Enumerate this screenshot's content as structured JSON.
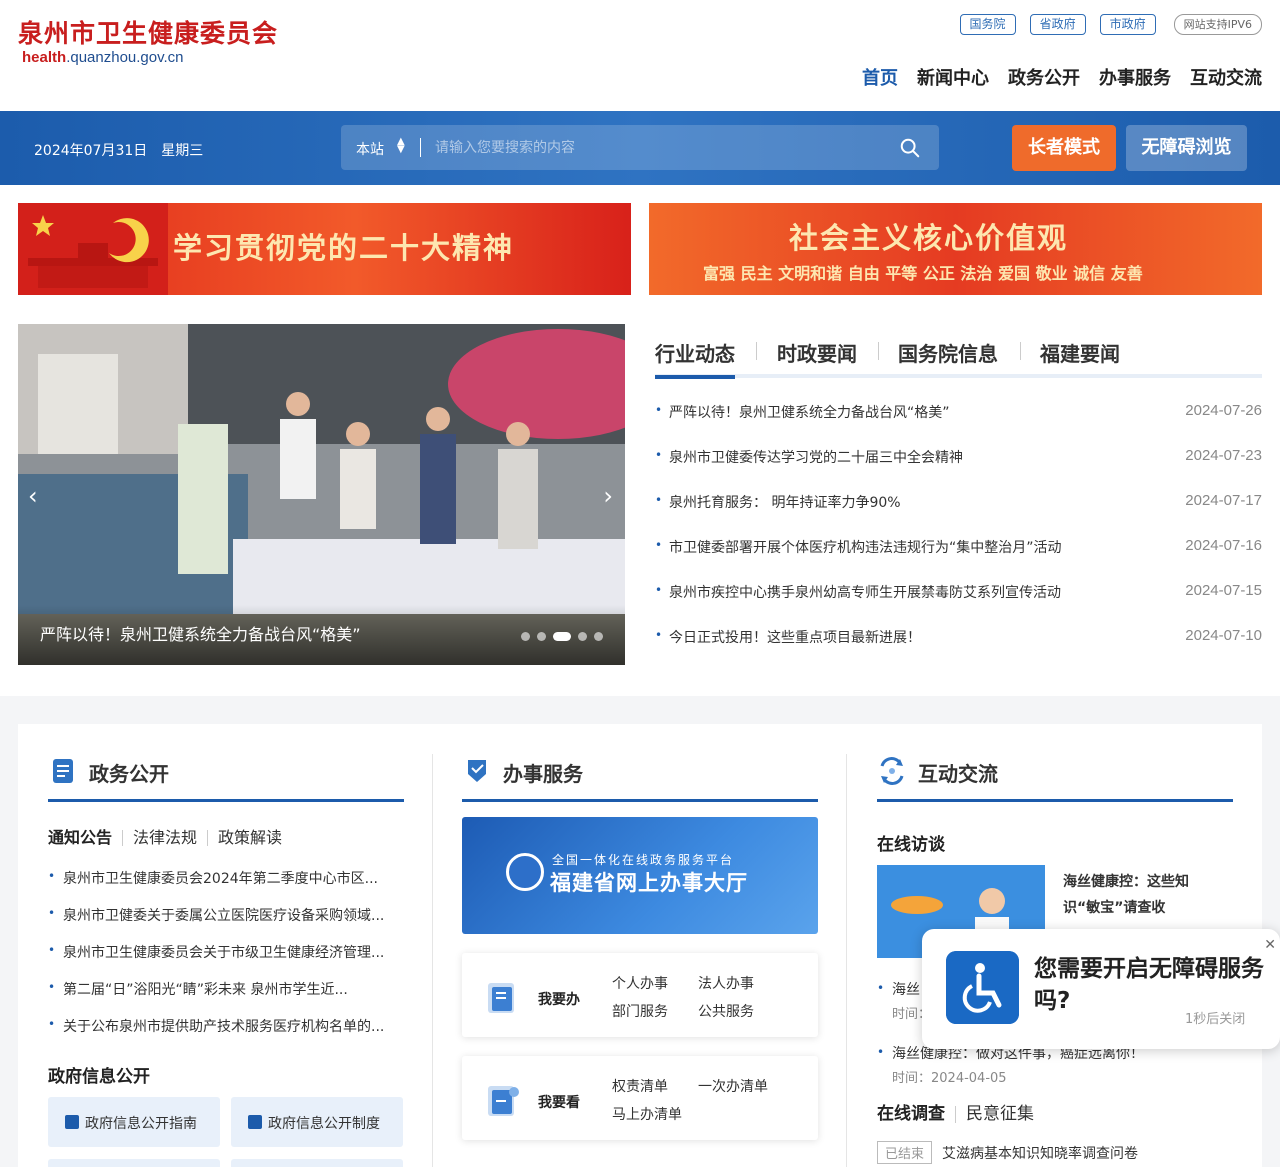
{
  "header": {
    "logo_cn": "泉州市卫生健康委员会",
    "logo_en_prefix": "health",
    "logo_en_suffix": ".quanzhou.gov.cn",
    "toplinks": [
      "国务院",
      "省政府",
      "市政府"
    ],
    "ipv6": "网站支持IPV6",
    "nav": [
      "首页",
      "新闻中心",
      "政务公开",
      "办事服务",
      "互动交流"
    ]
  },
  "bar": {
    "date": "2024年07月31日　星期三",
    "search_scope": "本站",
    "search_placeholder": "请输入您要搜索的内容",
    "elder_mode": "长者模式",
    "accessible": "无障碍浏览"
  },
  "banners": {
    "b1": "学习贯彻党的二十大精神",
    "b2_title": "社会主义核心价值观",
    "b2_sub": "富强 民主 文明和谐 自由 平等 公正 法治 爱国 敬业 诚信 友善"
  },
  "carousel": {
    "caption": "严阵以待！泉州卫健系统全力备战台风“格美”",
    "dot_count": 5,
    "active_dot": 3
  },
  "news": {
    "tabs": [
      "行业动态",
      "时政要闻",
      "国务院信息",
      "福建要闻"
    ],
    "items": [
      {
        "title": "严阵以待！泉州卫健系统全力备战台风“格美”",
        "date": "2024-07-26"
      },
      {
        "title": "泉州市卫健委传达学习党的二十届三中全会精神",
        "date": "2024-07-23"
      },
      {
        "title": "泉州托育服务： 明年持证率力争90%",
        "date": "2024-07-17"
      },
      {
        "title": "市卫健委部署开展个体医疗机构违法违规行为“集中整治月”活动",
        "date": "2024-07-16"
      },
      {
        "title": "泉州市疾控中心携手泉州幼高专师生开展禁毒防艾系列宣传活动",
        "date": "2024-07-15"
      },
      {
        "title": "今日正式投用！这些重点项目最新进展！",
        "date": "2024-07-10"
      }
    ]
  },
  "gov": {
    "title": "政务公开",
    "subtabs": [
      "通知公告",
      "法律法规",
      "政策解读"
    ],
    "items": [
      "泉州市卫生健康委员会2024年第二季度中心市区...",
      "泉州市卫健委关于委属公立医院医疗设备采购领域...",
      "泉州市卫生健康委员会关于市级卫生健康经济管理...",
      "第二届“日”浴阳光“睛”彩未来 泉州市学生近...",
      "关于公布泉州市提供助产技术服务医疗机构名单的..."
    ],
    "info_head": "政府信息公开",
    "info_btns": [
      "政府信息公开指南",
      "政府信息公开制度"
    ]
  },
  "service": {
    "title": "办事服务",
    "banner_line1": "全国一体化在线政务服务平台",
    "banner_line2": "福建省网上办事大厅",
    "card1": {
      "label": "我要办",
      "links": [
        "个人办事",
        "法人办事",
        "部门服务",
        "公共服务"
      ]
    },
    "card2": {
      "label": "我要看",
      "links": [
        "权责清单",
        "一次办清单",
        "马上办清单"
      ]
    }
  },
  "interact": {
    "title": "互动交流",
    "online": "在线访谈",
    "thumb_text": "海丝健康控：这些知识“敏宝”请查收",
    "items": [
      {
        "title": "海丝",
        "date": "时间："
      },
      {
        "title": "海丝健康控：做对这件事，癌症远离你！",
        "date": "时间：2024-04-05"
      }
    ],
    "survey_tabs": [
      "在线调查",
      "民意征集"
    ],
    "survey_tag": "已结束",
    "survey_title": "艾滋病基本知识知晓率调查问卷"
  },
  "popup": {
    "text": "您需要开启无障碍服务吗?",
    "close_hint": "1秒后关闭",
    "x": "✕"
  }
}
